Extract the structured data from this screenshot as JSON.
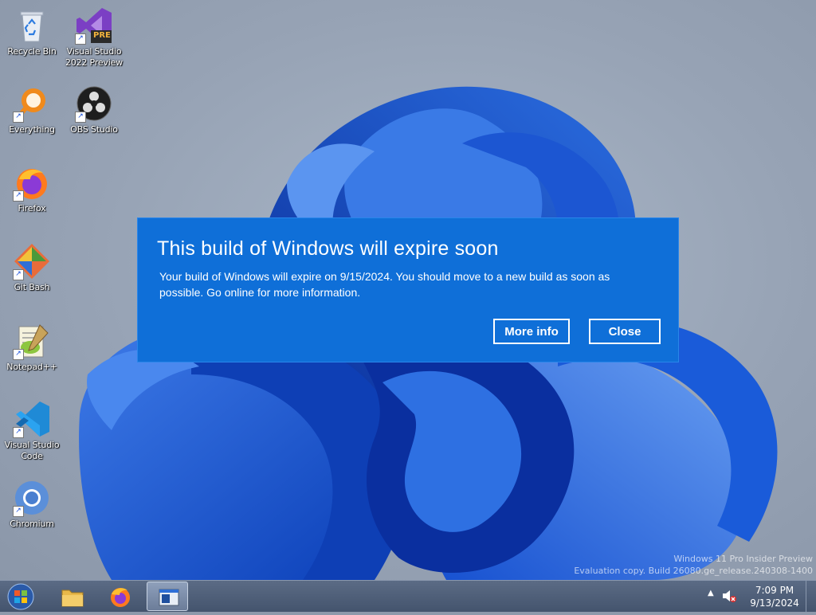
{
  "desktop": {
    "icons": [
      {
        "label": "Recycle Bin"
      },
      {
        "label": "Visual Studio 2022 Preview",
        "badge": "PRE"
      },
      {
        "label": "Everything"
      },
      {
        "label": "OBS Studio"
      },
      {
        "label": "Firefox"
      },
      {
        "label": "Git Bash"
      },
      {
        "label": "Notepad++"
      },
      {
        "label": "Visual Studio Code"
      },
      {
        "label": "Chromium"
      }
    ]
  },
  "dialog": {
    "title": "This build of Windows will expire soon",
    "message": "Your build of Windows will expire on 9/15/2024. You should move to a new build as soon as possible. Go online for more information.",
    "more_info_label": "More info",
    "close_label": "Close",
    "background_color": "#0f6fd8"
  },
  "watermark": {
    "line1": "Windows 11 Pro Insider Preview",
    "line2": "Evaluation copy. Build 26080.ge_release.240308-1400"
  },
  "taskbar": {
    "items": [
      "start-icon",
      "file-explorer-icon",
      "firefox-icon",
      "app-window-icon"
    ],
    "tray": {
      "chevron": "▲",
      "volume_icon": "speaker-muted-icon"
    },
    "clock": {
      "time": "7:09 PM",
      "date": "9/13/2024"
    }
  }
}
